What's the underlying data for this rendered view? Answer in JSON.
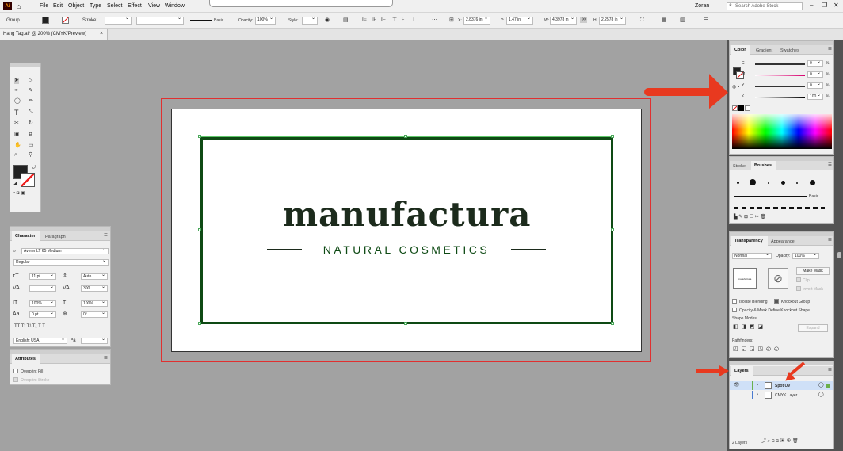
{
  "menubar": {
    "app_logo": "Ai",
    "items": [
      "File",
      "Edit",
      "Object",
      "Type",
      "Select",
      "Effect",
      "View",
      "Window"
    ],
    "user": "Zoran",
    "search_placeholder": "Search Adobe Stock"
  },
  "control": {
    "selection": "Group",
    "stroke_label": "Stroke:",
    "brush": "Basic",
    "opacity_label": "Opacity:",
    "opacity": "100%",
    "style_label": "Style:",
    "x_label": "X:",
    "x": "2.8376 in",
    "y_label": "Y:",
    "y": "1.47 in",
    "w_label": "W:",
    "w": "4.3978 in",
    "h_label": "H:",
    "h": "2.2578 in"
  },
  "document": {
    "tab": "Hang Tag.ai* @ 200% (CMYK/Preview)",
    "logo_word": "manufactura",
    "logo_sub": "NATURAL COSMETICS"
  },
  "color_panel": {
    "tabs": [
      "Color",
      "Gradient",
      "Swatches"
    ],
    "channels": [
      {
        "label": "C",
        "value": "0"
      },
      {
        "label": "M",
        "value": "0"
      },
      {
        "label": "Y",
        "value": "0"
      },
      {
        "label": "K",
        "value": "100"
      }
    ],
    "unit": "%"
  },
  "brushes_panel": {
    "tabs": [
      "Stroke",
      "Brushes"
    ],
    "basic": "Basic"
  },
  "transparency_panel": {
    "tabs": [
      "Transparency",
      "Appearance"
    ],
    "blend": "Normal",
    "opacity_label": "Opacity:",
    "opacity": "100%",
    "make_mask": "Make Mask",
    "clip": "Clip",
    "invert": "Invert Mask",
    "isolate": "Isolate Blending",
    "knockout": "Knockout Group",
    "opacity_mask": "Opacity & Mask Define Knockout Shape",
    "shape_modes": "Shape Modes:",
    "expand": "Expand",
    "pathfinders": "Pathfinders:"
  },
  "layers_panel": {
    "tab": "Layers",
    "layers": [
      {
        "name": "Spot UV",
        "selected": true
      },
      {
        "name": "CMYK Layer",
        "selected": false
      }
    ],
    "count": "2 Layers"
  },
  "character_panel": {
    "tabs": [
      "Character",
      "Paragraph"
    ],
    "font": "Averer LT 65 Medium",
    "style": "Regular",
    "size": "11 pt",
    "leading": "Auto",
    "tracking": "300",
    "scale_v": "100%",
    "scale_h": "100%",
    "baseline": "0 pt",
    "rotation": "0°",
    "language": "English: USA"
  },
  "attributes_panel": {
    "title": "Attributes",
    "overprint_fill": "Overprint Fill",
    "overprint_stroke": "Overprint Stroke"
  },
  "colors": {
    "arrow": "#e8391f",
    "logo": "#1c2b1c",
    "border": "#0e4a14",
    "bleed": "#e03030"
  }
}
